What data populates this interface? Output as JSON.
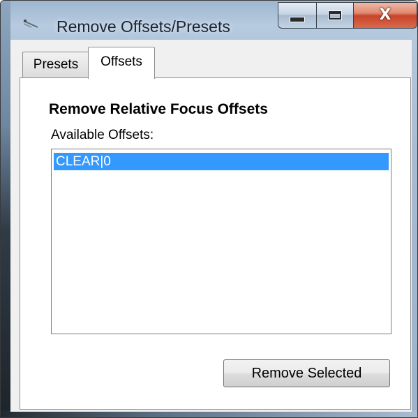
{
  "window": {
    "title": "Remove Offsets/Presets",
    "icon": "app-icon",
    "controls": {
      "minimize_icon": "minimize-icon",
      "maximize_icon": "maximize-icon",
      "close_glyph": "X"
    }
  },
  "tabs": [
    {
      "label": "Presets",
      "active": false
    },
    {
      "label": "Offsets",
      "active": true
    }
  ],
  "offsets_tab": {
    "heading": "Remove Relative Focus Offsets",
    "list_label": "Available Offsets:",
    "items": [
      {
        "label": "CLEAR|0",
        "selected": true
      }
    ],
    "remove_button_label": "Remove Selected"
  },
  "colors": {
    "selection": "#3399ff",
    "close_button": "#c8452b"
  }
}
